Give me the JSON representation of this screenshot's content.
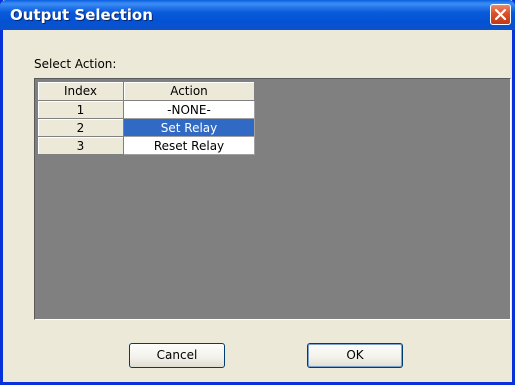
{
  "window": {
    "title": "Output Selection"
  },
  "label": "Select Action:",
  "grid": {
    "columns": [
      "Index",
      "Action"
    ],
    "rows": [
      {
        "index": "1",
        "action": "-NONE-"
      },
      {
        "index": "2",
        "action": "Set Relay"
      },
      {
        "index": "3",
        "action": "Reset Relay"
      }
    ],
    "selected_row": 1
  },
  "buttons": {
    "cancel": "Cancel",
    "ok": "OK"
  },
  "colors": {
    "titlebar": "#0a5cdc",
    "selection": "#316ac5",
    "grid_background": "#808080",
    "dialog_background": "#ece9d8"
  },
  "icons": {
    "close": "close-icon"
  }
}
